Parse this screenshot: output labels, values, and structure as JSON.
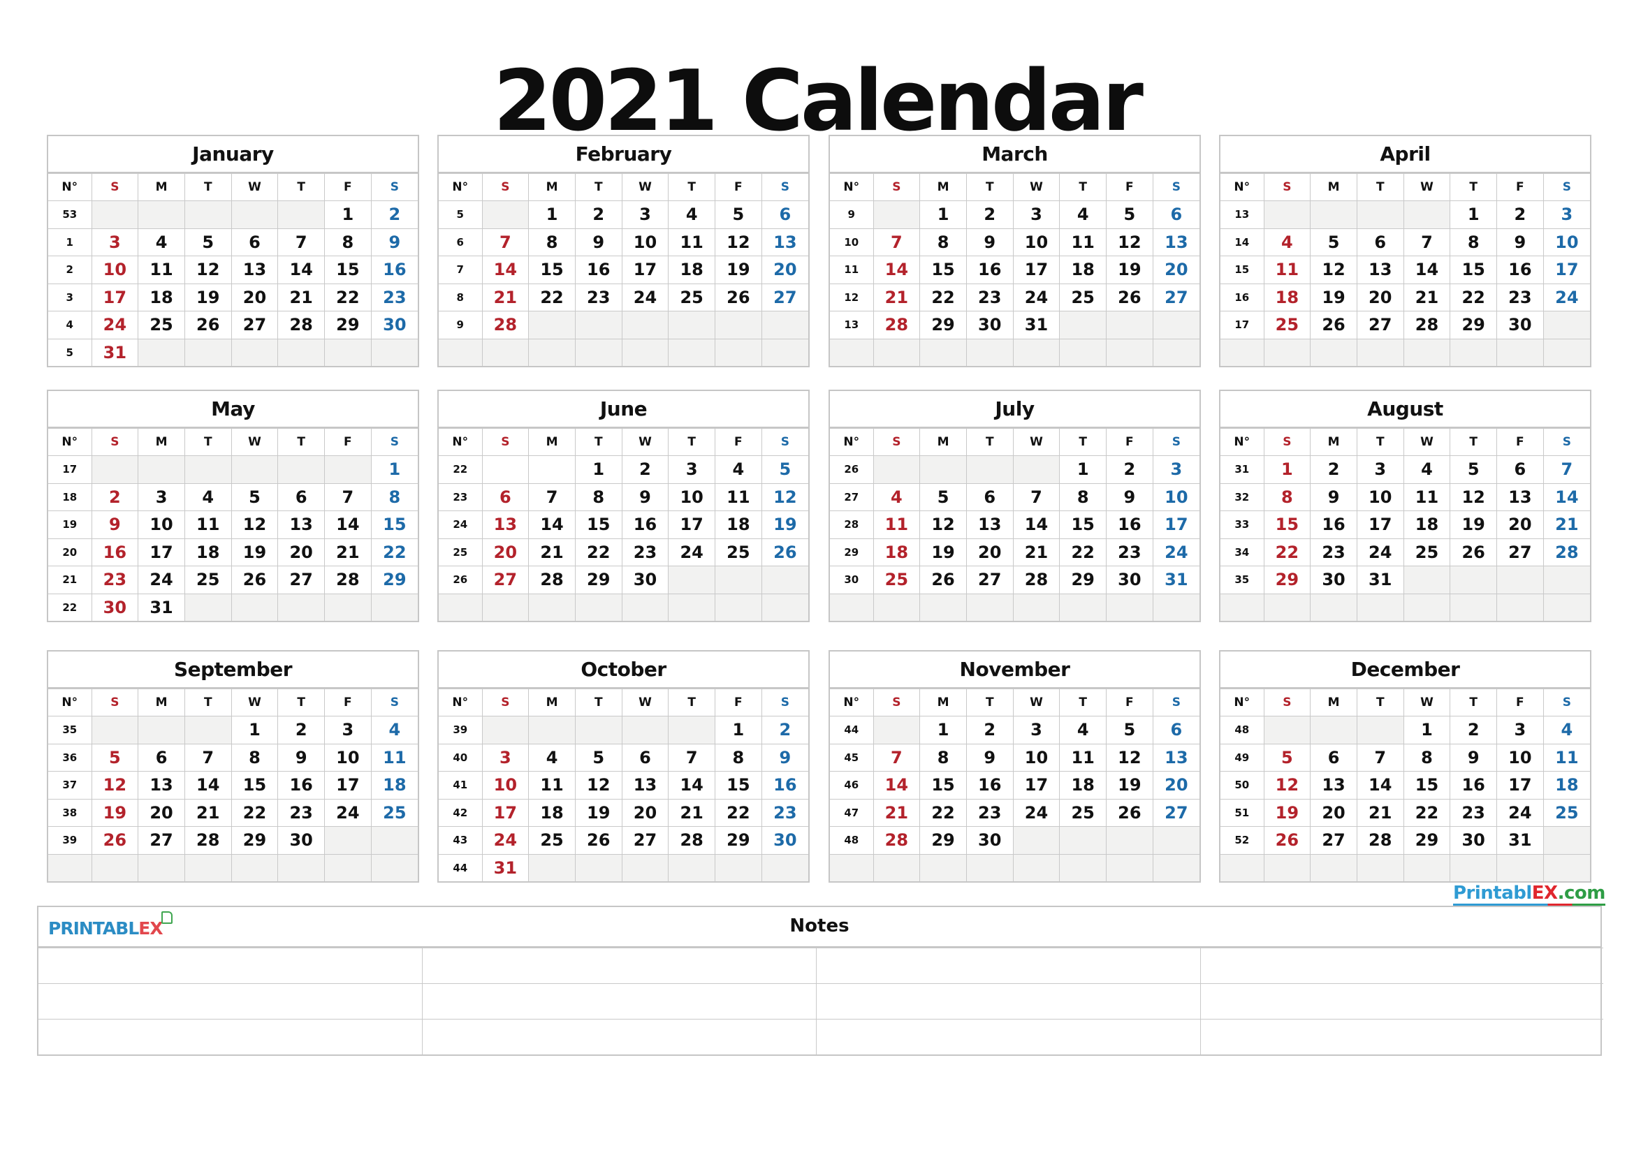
{
  "title": "2021 Calendar",
  "weekday_headers": [
    "N°",
    "S",
    "M",
    "T",
    "W",
    "T",
    "F",
    "S"
  ],
  "colors": {
    "sunday": "#b3222b",
    "saturday": "#1d6aa8",
    "empty_fill": "#f2f2f1",
    "border": "#c6c6c6"
  },
  "months": [
    {
      "name": "January",
      "first_weekday": 5,
      "days": 31,
      "weeks": [
        "53",
        "1",
        "2",
        "3",
        "4",
        "5"
      ]
    },
    {
      "name": "February",
      "first_weekday": 1,
      "days": 28,
      "weeks": [
        "5",
        "6",
        "7",
        "8",
        "9",
        ""
      ]
    },
    {
      "name": "March",
      "first_weekday": 1,
      "days": 31,
      "weeks": [
        "9",
        "10",
        "11",
        "12",
        "13",
        ""
      ]
    },
    {
      "name": "April",
      "first_weekday": 4,
      "days": 30,
      "weeks": [
        "13",
        "14",
        "15",
        "16",
        "17",
        ""
      ]
    },
    {
      "name": "May",
      "first_weekday": 6,
      "days": 31,
      "weeks": [
        "17",
        "18",
        "19",
        "20",
        "21",
        "22"
      ]
    },
    {
      "name": "June",
      "first_weekday": 2,
      "days": 30,
      "weeks": [
        "22",
        "23",
        "24",
        "25",
        "26",
        ""
      ],
      "leading_blank_white": true
    },
    {
      "name": "July",
      "first_weekday": 4,
      "days": 31,
      "weeks": [
        "26",
        "27",
        "28",
        "29",
        "30",
        ""
      ]
    },
    {
      "name": "August",
      "first_weekday": 0,
      "days": 31,
      "weeks": [
        "31",
        "32",
        "33",
        "34",
        "35",
        ""
      ]
    },
    {
      "name": "September",
      "first_weekday": 3,
      "days": 30,
      "weeks": [
        "35",
        "36",
        "37",
        "38",
        "39",
        ""
      ]
    },
    {
      "name": "October",
      "first_weekday": 5,
      "days": 31,
      "weeks": [
        "39",
        "40",
        "41",
        "42",
        "43",
        "44"
      ]
    },
    {
      "name": "November",
      "first_weekday": 1,
      "days": 30,
      "weeks": [
        "44",
        "45",
        "46",
        "47",
        "48",
        ""
      ]
    },
    {
      "name": "December",
      "first_weekday": 3,
      "days": 31,
      "weeks": [
        "48",
        "49",
        "50",
        "51",
        "52",
        ""
      ]
    }
  ],
  "notes": {
    "title": "Notes",
    "rows": 3,
    "columns": 4,
    "logo_left": {
      "part1": "PRINTABL",
      "part2": "EX"
    }
  },
  "brand_right": {
    "part1": "Printabl",
    "part2": "EX",
    "part3": ".com"
  }
}
